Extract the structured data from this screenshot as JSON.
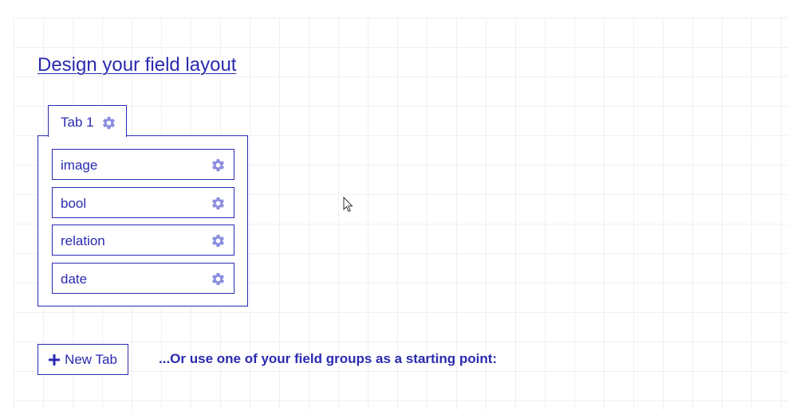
{
  "heading": "Design your field layout",
  "tabs": [
    {
      "label": "Tab 1",
      "icon": "gear-icon",
      "fields": [
        {
          "label": "image",
          "icon": "gear-icon"
        },
        {
          "label": "bool",
          "icon": "gear-icon"
        },
        {
          "label": "relation",
          "icon": "gear-icon"
        },
        {
          "label": "date",
          "icon": "gear-icon"
        }
      ]
    }
  ],
  "new_tab_button": {
    "label": "New Tab",
    "icon": "plus-icon"
  },
  "field_groups_hint": "...Or use one of your field groups as a starting point:",
  "colors": {
    "primary": "#2a2ab0",
    "gear": "#8b8ddf",
    "grid": "#eef0f8",
    "background": "#ffffff"
  }
}
